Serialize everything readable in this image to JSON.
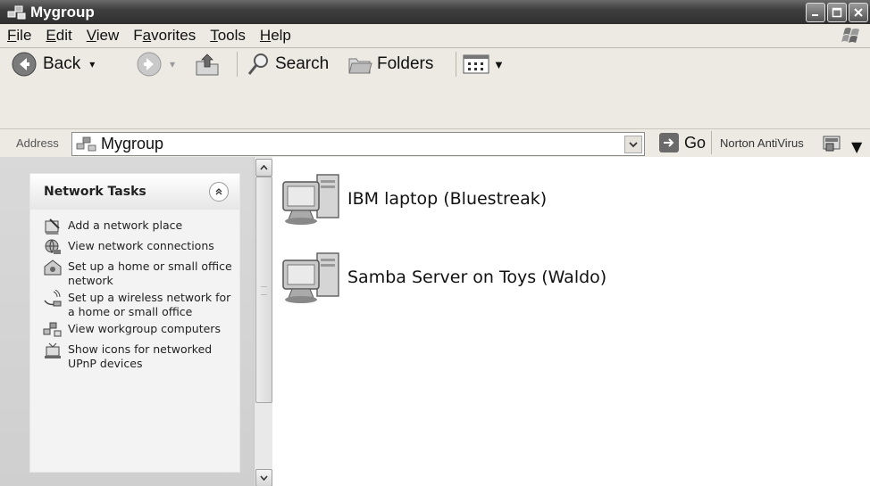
{
  "window": {
    "title": "Mygroup"
  },
  "menu": {
    "items": [
      {
        "label": "File",
        "accel": "F",
        "rest": "ile"
      },
      {
        "label": "Edit",
        "accel": "E",
        "rest": "dit"
      },
      {
        "label": "View",
        "accel": "V",
        "rest": "iew"
      },
      {
        "label": "Favorites",
        "pre": "F",
        "accel": "a",
        "rest": "vorites"
      },
      {
        "label": "Tools",
        "accel": "T",
        "rest": "ools"
      },
      {
        "label": "Help",
        "accel": "H",
        "rest": "elp"
      }
    ]
  },
  "toolbar": {
    "back_label": "Back",
    "search_label": "Search",
    "folders_label": "Folders"
  },
  "address": {
    "label": "Address",
    "value": "Mygroup",
    "go_label": "Go",
    "norton_label": "Norton AntiVirus"
  },
  "tasks": {
    "title": "Network Tasks",
    "items": [
      {
        "label": "Add a network place",
        "icon": "add-network-place-icon"
      },
      {
        "label": "View network connections",
        "icon": "network-connections-icon"
      },
      {
        "label": "Set up a home or small office network",
        "icon": "home-network-icon"
      },
      {
        "label": "Set up a wireless network for a home or small office",
        "icon": "wireless-network-icon"
      },
      {
        "label": "View workgroup computers",
        "icon": "workgroup-icon"
      },
      {
        "label": "Show icons for networked UPnP devices",
        "icon": "upnp-device-icon"
      }
    ]
  },
  "computers": [
    {
      "label": "IBM laptop (Bluestreak)",
      "icon": "computer-icon"
    },
    {
      "label": "Samba Server on Toys (Waldo)",
      "icon": "computer-icon"
    }
  ],
  "colors": {
    "titlebar": "#3f3f3f",
    "chrome": "#eceae3",
    "taskpane": "#d5d5d5"
  }
}
